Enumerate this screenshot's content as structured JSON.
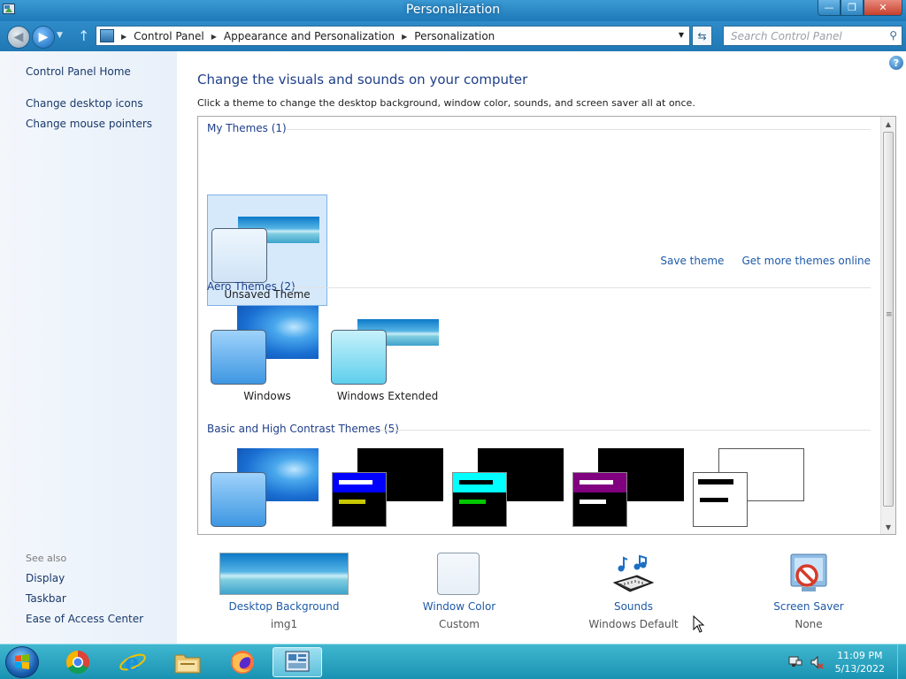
{
  "window": {
    "title": "Personalization"
  },
  "titlebar": {
    "minimize_glyph": "—",
    "maximize_glyph": "❐",
    "close_glyph": "✕"
  },
  "addressbar": {
    "crumbs": [
      "Control Panel",
      "Appearance and Personalization",
      "Personalization"
    ],
    "search_placeholder": "Search Control Panel"
  },
  "sidebar": {
    "home": "Control Panel Home",
    "tasks": [
      "Change desktop icons",
      "Change mouse pointers"
    ],
    "see_also_header": "See also",
    "see_also": [
      "Display",
      "Taskbar",
      "Ease of Access Center"
    ]
  },
  "main": {
    "heading": "Change the visuals and sounds on your computer",
    "subtitle": "Click a theme to change the desktop background, window color, sounds, and screen saver all at once.",
    "groups": {
      "my_themes": "My Themes (1)",
      "aero_themes": "Aero Themes (2)",
      "basic_themes": "Basic and High Contrast Themes (5)"
    },
    "my_themes": [
      {
        "label": "Unsaved Theme"
      }
    ],
    "aero_themes": [
      {
        "label": "Windows"
      },
      {
        "label": "Windows Extended"
      }
    ],
    "basic_themes": [
      {
        "name": "windows-basic"
      },
      {
        "name": "high-contrast-1",
        "bar_color": "#0000ff",
        "line2_color": "#c8c800"
      },
      {
        "name": "high-contrast-2",
        "bar_color": "#00ffff",
        "line2_color": "#00c800"
      },
      {
        "name": "high-contrast-black",
        "bar_color": "#800080",
        "line2_color": "#ffffff"
      },
      {
        "name": "high-contrast-white"
      }
    ],
    "links": {
      "save_theme": "Save theme",
      "get_more": "Get more themes online"
    }
  },
  "settings": [
    {
      "label": "Desktop Background",
      "value": "img1"
    },
    {
      "label": "Window Color",
      "value": "Custom"
    },
    {
      "label": "Sounds",
      "value": "Windows Default"
    },
    {
      "label": "Screen Saver",
      "value": "None"
    }
  ],
  "taskbar": {
    "apps": [
      "chrome-icon",
      "internet-explorer-icon",
      "file-explorer-icon",
      "firefox-icon",
      "control-panel-icon"
    ],
    "clock": {
      "time": "11:09 PM",
      "date": "5/13/2022"
    }
  },
  "colors": {
    "link": "#1e5aa8",
    "heading": "#1e3f8a",
    "titlebar": "#2a8ac7",
    "taskbar": "#2ba6c4"
  }
}
